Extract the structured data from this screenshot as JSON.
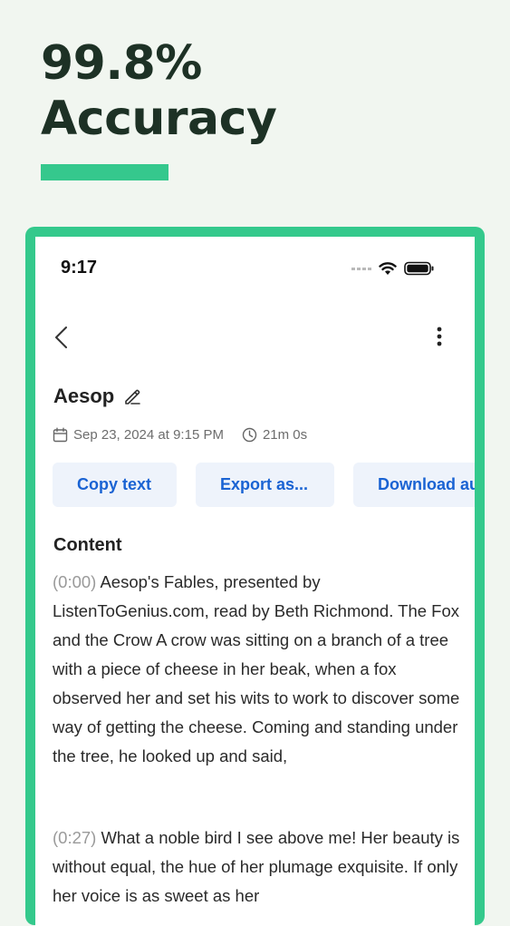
{
  "headline": {
    "line1": "99.8%",
    "line2": "Accuracy"
  },
  "colors": {
    "accent": "#35c88d",
    "frame": "#34c98c",
    "button_text": "#1a63d3",
    "button_bg": "#eef3fb"
  },
  "status_bar": {
    "time": "9:17",
    "icons": [
      "signal-dots-icon",
      "wifi-icon",
      "battery-icon"
    ]
  },
  "nav": {
    "back_icon": "chevron-left-icon",
    "more_icon": "more-vertical-icon"
  },
  "document": {
    "title": "Aesop",
    "date": "Sep 23, 2024 at 9:15 PM",
    "duration": "21m 0s"
  },
  "actions": [
    {
      "label": "Copy text"
    },
    {
      "label": "Export as..."
    },
    {
      "label": "Download au"
    }
  ],
  "content": {
    "heading": "Content",
    "paragraphs": [
      {
        "timestamp": "(0:00)",
        "text": "Aesop's Fables, presented by ListenToGenius.com, read by Beth Richmond. The Fox and the Crow A crow was sitting on a branch of a tree with a piece of cheese in her beak, when a fox observed her and set his wits to work to discover some way of getting the cheese. Coming and standing under the tree, he looked up and said,"
      },
      {
        "timestamp": "(0:27)",
        "text": "What a noble bird I see above me! Her beauty is without equal, the hue of her plumage exquisite. If only her voice is as sweet as her"
      }
    ]
  }
}
